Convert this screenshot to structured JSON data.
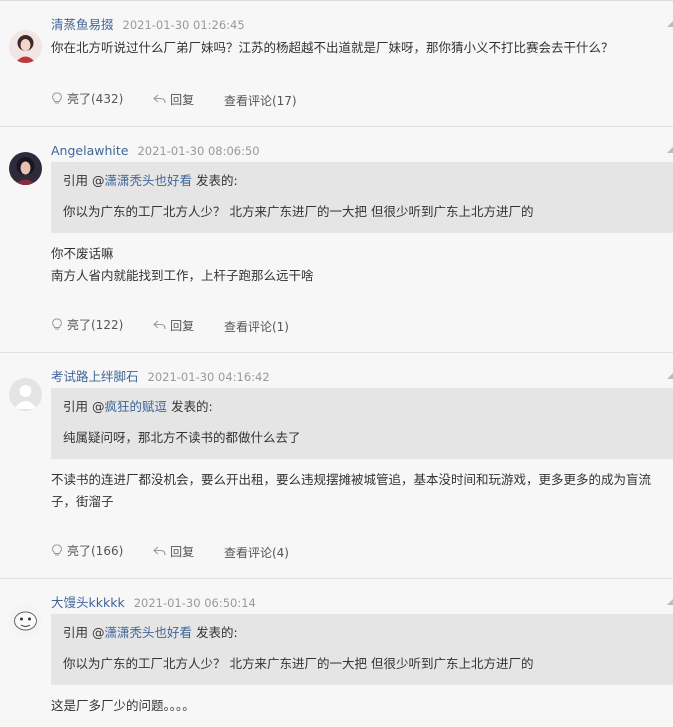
{
  "comments": [
    {
      "username": "清蒸鱼易掇",
      "time": "2021-01-30 01:26:45",
      "text_lines": [
        "你在北方听说过什么厂弟厂妹吗？江苏的杨超越不出道就是厂妹呀，那你猜小义不打比赛会去干什么？"
      ],
      "likes_label": "亮了(432)",
      "reply_label": "回复",
      "view_label": "查看评论(17)"
    },
    {
      "username": "Angelawhite",
      "time": "2021-01-30 08:06:50",
      "quote": {
        "prefix": "引用 @",
        "user": "潇潇秃头也好看",
        "suffix": " 发表的:",
        "text": "你以为广东的工厂北方人少？ 北方来广东进厂的一大把 但很少听到广东上北方进厂的"
      },
      "text_lines": [
        "你不废话嘛",
        "南方人省内就能找到工作，上杆子跑那么远干啥"
      ],
      "likes_label": "亮了(122)",
      "reply_label": "回复",
      "view_label": "查看评论(1)"
    },
    {
      "username": "考试路上绊脚石",
      "time": "2021-01-30 04:16:42",
      "quote": {
        "prefix": "引用 @",
        "user": "疯狂的赋逗",
        "suffix": " 发表的:",
        "text": "纯属疑问呀，那北方不读书的都做什么去了"
      },
      "text_lines": [
        "不读书的连进厂都没机会，要么开出租，要么违规摆摊被城管追，基本没时间和玩游戏，更多更多的成为盲流子，街溜子"
      ],
      "likes_label": "亮了(166)",
      "reply_label": "回复",
      "view_label": "查看评论(4)"
    },
    {
      "username": "大馒头kkkkk",
      "time": "2021-01-30 06:50:14",
      "quote": {
        "prefix": "引用 @",
        "user": "潇潇秃头也好看",
        "suffix": " 发表的:",
        "text": "你以为广东的工厂北方人少？ 北方来广东进厂的一大把 但很少听到广东上北方进厂的"
      },
      "text_lines": [
        "这是厂多厂少的问题。。。。"
      ]
    }
  ],
  "colors": {
    "link": "#406599",
    "quote_bg": "#e5e5e5",
    "divider": "#e1e1e1",
    "page_bg": "#f7f7f7"
  },
  "icons": {
    "like": "light-bulb-icon",
    "reply": "reply-arrow-icon",
    "avatar_default": "default-user-icon"
  }
}
